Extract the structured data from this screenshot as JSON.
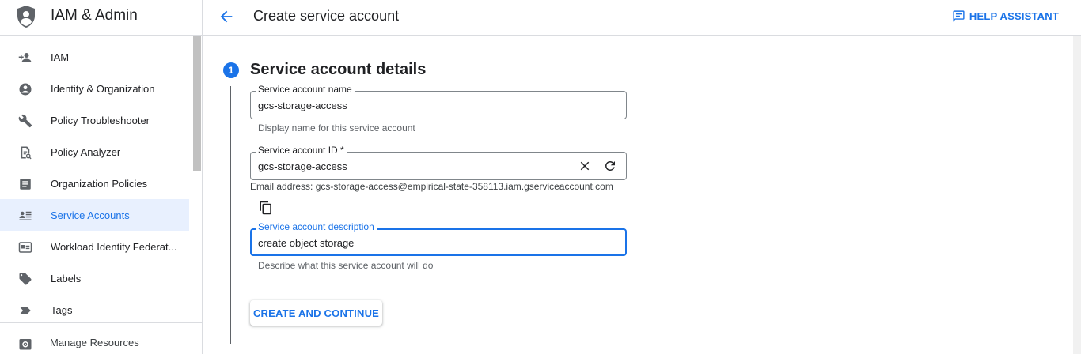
{
  "sidebar": {
    "title": "IAM & Admin",
    "items": [
      {
        "label": "IAM",
        "icon": "person-add-icon"
      },
      {
        "label": "Identity & Organization",
        "icon": "account-circle-icon"
      },
      {
        "label": "Policy Troubleshooter",
        "icon": "wrench-icon"
      },
      {
        "label": "Policy Analyzer",
        "icon": "policy-document-icon"
      },
      {
        "label": "Organization Policies",
        "icon": "list-document-icon"
      },
      {
        "label": "Service Accounts",
        "icon": "service-account-icon",
        "active": true
      },
      {
        "label": "Workload Identity Federat...",
        "icon": "id-card-icon"
      },
      {
        "label": "Labels",
        "icon": "label-icon"
      },
      {
        "label": "Tags",
        "icon": "tag-icon"
      }
    ],
    "footer_label": "Manage Resources"
  },
  "topbar": {
    "title": "Create service account",
    "help_label": "HELP ASSISTANT"
  },
  "form": {
    "step_number": "1",
    "section_title": "Service account details",
    "name_label": "Service account name",
    "name_value": "gcs-storage-access",
    "name_hint": "Display name for this service account",
    "id_label": "Service account ID *",
    "id_value": "gcs-storage-access",
    "email_line": "Email address: gcs-storage-access@empirical-state-358113.iam.gserviceaccount.com",
    "desc_label": "Service account description",
    "desc_value": "create object storage",
    "desc_hint": "Describe what this service account will do",
    "create_button": "CREATE AND CONTINUE"
  },
  "colors": {
    "accent": "#1a73e8",
    "active_bg": "#e8f0fe",
    "icon": "#5f6368"
  }
}
